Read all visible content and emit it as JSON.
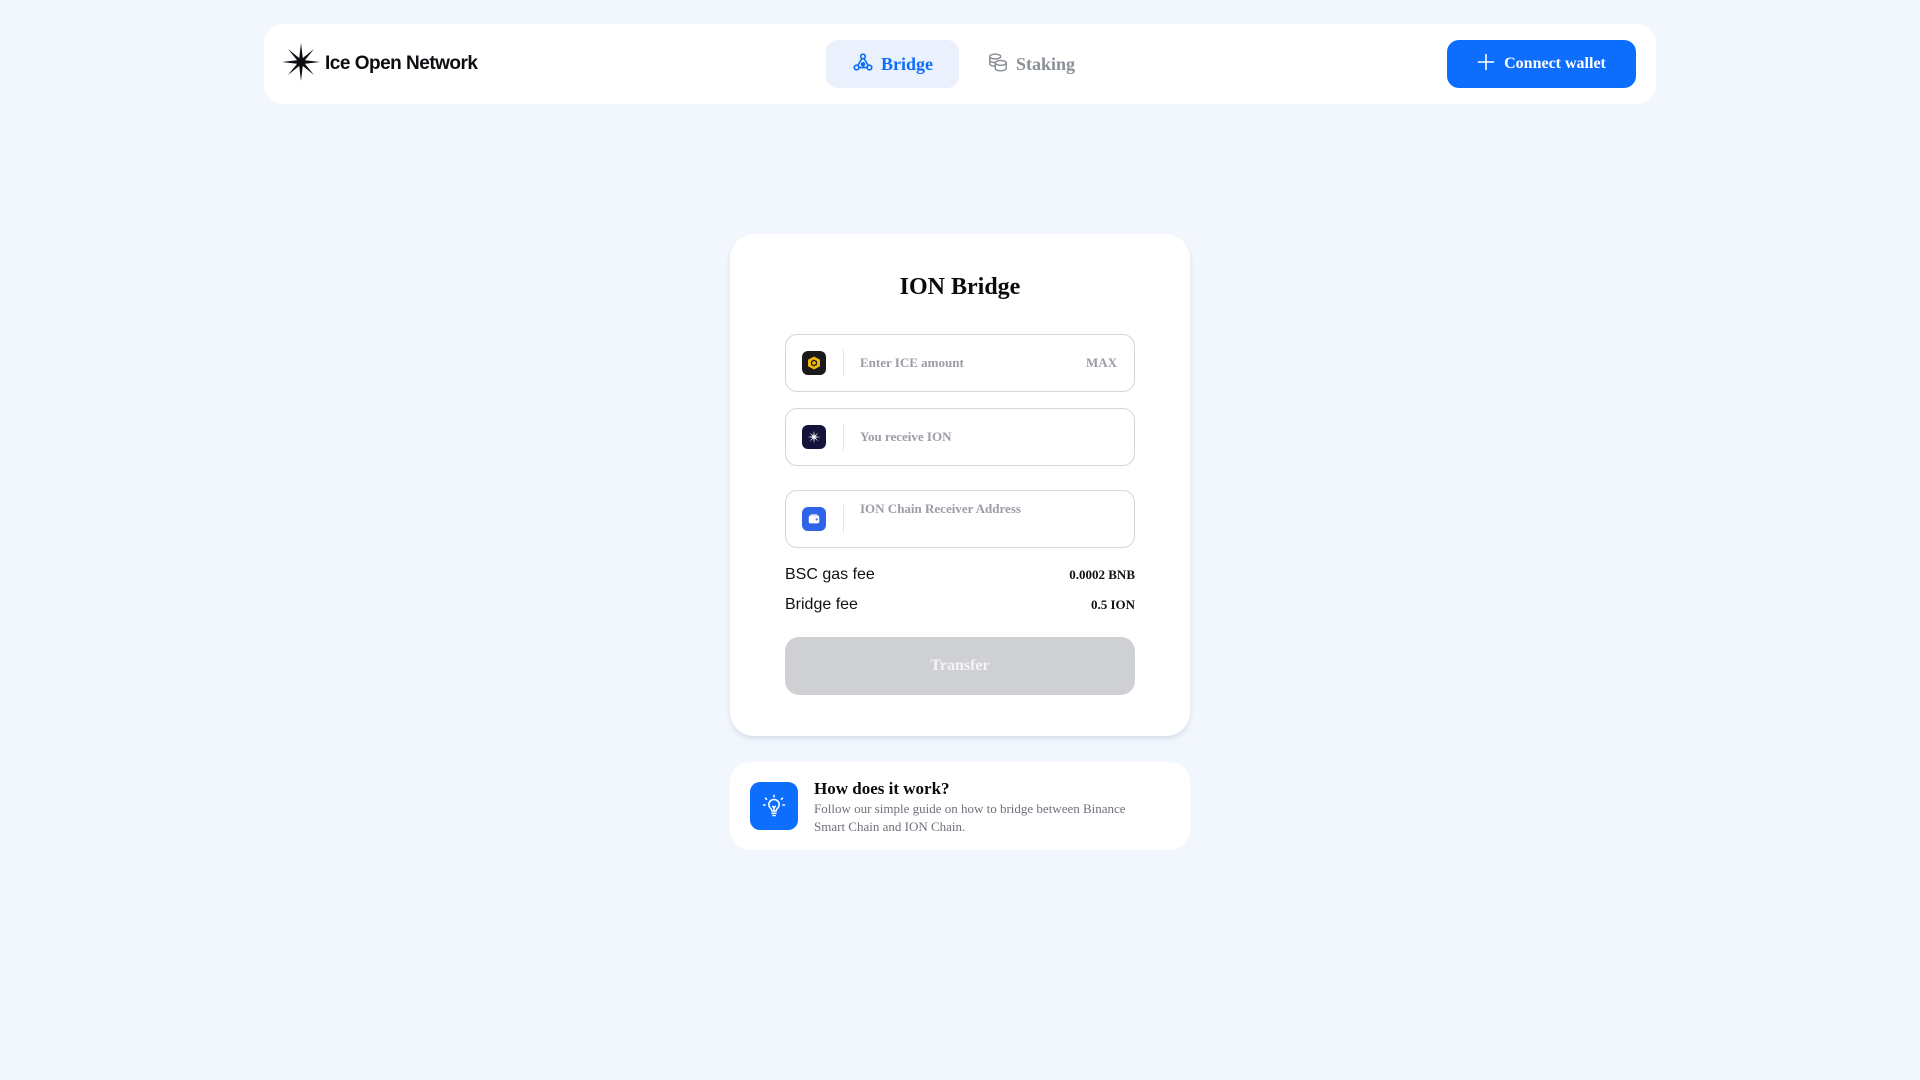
{
  "header": {
    "logo_text": "Ice Open Network",
    "nav": [
      {
        "label": "Bridge",
        "icon": "bridge-icon",
        "active": true
      },
      {
        "label": "Staking",
        "icon": "coins-icon",
        "active": false
      }
    ],
    "connect_label": "Connect wallet"
  },
  "bridge": {
    "title": "ION Bridge",
    "amount_field": {
      "placeholder": "Enter ICE amount",
      "value": "",
      "icon": "bnb-token-icon",
      "max_label": "MAX"
    },
    "receive_field": {
      "placeholder": "You receive ION",
      "value": "",
      "icon": "ion-token-icon"
    },
    "address_field": {
      "placeholder": "ION Chain Receiver Address",
      "value": "",
      "icon": "wallet-icon"
    },
    "fees": [
      {
        "label": "BSC gas fee",
        "value": "0.0002 BNB"
      },
      {
        "label": "Bridge fee",
        "value": "0.5 ION"
      }
    ],
    "transfer_label": "Transfer"
  },
  "guide": {
    "icon": "lightbulb-icon",
    "title": "How does it work?",
    "description": "Follow our simple guide on how to bridge between Binance Smart Chain and ION Chain."
  },
  "colors": {
    "accent": "#0d6efd",
    "page_bg": "#f2f6fd",
    "disabled_button": "#cfd0d3"
  }
}
